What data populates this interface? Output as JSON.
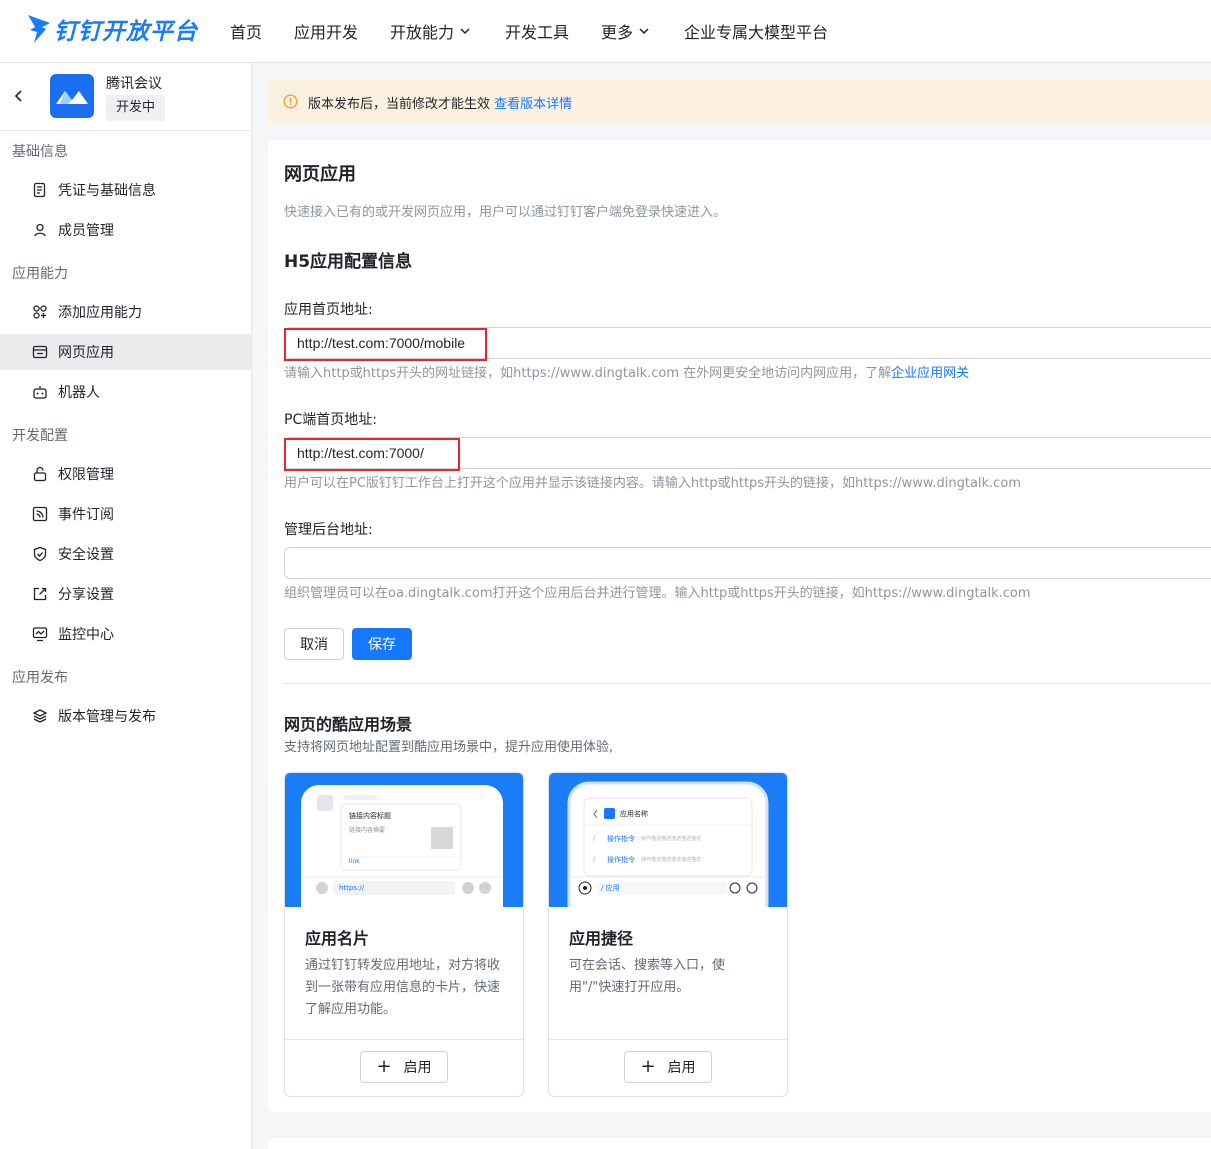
{
  "topnav": {
    "logo_text": "钉钉开放平台",
    "items": [
      "首页",
      "应用开发",
      "开放能力",
      "开发工具",
      "更多",
      "企业专属大模型平台"
    ]
  },
  "app": {
    "name": "腾讯会议",
    "status": "开发中"
  },
  "sidebar": {
    "sections": [
      {
        "title": "基础信息",
        "items": [
          {
            "label": "凭证与基础信息",
            "icon": "credential-icon"
          },
          {
            "label": "成员管理",
            "icon": "user-icon"
          }
        ]
      },
      {
        "title": "应用能力",
        "items": [
          {
            "label": "添加应用能力",
            "icon": "add-capability-icon"
          },
          {
            "label": "网页应用",
            "icon": "webpage-icon",
            "active": true
          },
          {
            "label": "机器人",
            "icon": "robot-icon"
          }
        ]
      },
      {
        "title": "开发配置",
        "items": [
          {
            "label": "权限管理",
            "icon": "lock-icon"
          },
          {
            "label": "事件订阅",
            "icon": "rss-icon"
          },
          {
            "label": "安全设置",
            "icon": "shield-icon"
          },
          {
            "label": "分享设置",
            "icon": "share-icon"
          },
          {
            "label": "监控中心",
            "icon": "monitor-icon"
          }
        ]
      },
      {
        "title": "应用发布",
        "items": [
          {
            "label": "版本管理与发布",
            "icon": "layers-icon"
          }
        ]
      }
    ]
  },
  "notice": {
    "text": "版本发布后，当前修改才能生效",
    "link": "查看版本详情"
  },
  "main": {
    "title": "网页应用",
    "description": "快速接入已有的或开发网页应用，用户可以通过钉钉客户端免登录快速进入。",
    "section_title": "H5应用配置信息",
    "fields": [
      {
        "label": "应用首页地址:",
        "value": "http://test.com:7000/mobile",
        "hint": "请输入http或https开头的网址链接，如https://www.dingtalk.com 在外网更安全地访问内网应用，了解",
        "hint_link": "企业应用网关"
      },
      {
        "label": "PC端首页地址:",
        "value": "http://test.com:7000/",
        "hint": "用户可以在PC版钉钉工作台上打开这个应用并显示该链接内容。请输入http或https开头的链接，如https://www.dingtalk.com",
        "hint_link": ""
      },
      {
        "label": "管理后台地址:",
        "value": "",
        "hint": "组织管理员可以在oa.dingtalk.com打开这个应用后台并进行管理。输入http或https开头的链接，如https://www.dingtalk.com",
        "hint_link": ""
      }
    ],
    "cancel_label": "取消",
    "save_label": "保存",
    "scene_title": "网页的酷应用场景",
    "scene_desc": "支持将网页地址配置到酷应用场景中，提升应用使用体验,",
    "scenes": [
      {
        "title": "应用名片",
        "desc": "通过钉钉转发应用地址，对方将收到一张带有应用信息的卡片，快速了解应用功能。",
        "button": "启用",
        "preview": {
          "card_title": "链接内容标题",
          "card_sub": "链接内容摘要",
          "card_link": "link",
          "input": "https://"
        }
      },
      {
        "title": "应用捷径",
        "desc": "可在会话、搜索等入口，使用\"/\"快速打开应用。",
        "button": "启用",
        "preview": {
          "app_name": "应用名称",
          "cmd": "操作指令",
          "cmd_desc": "操作描述描述描述描述描述",
          "input": "/ 应用"
        }
      }
    ]
  },
  "colors": {
    "brand": "#1677ff",
    "notice_bg": "#fcf0e1",
    "warn": "#f29d38",
    "highlight": "#e5262b"
  }
}
